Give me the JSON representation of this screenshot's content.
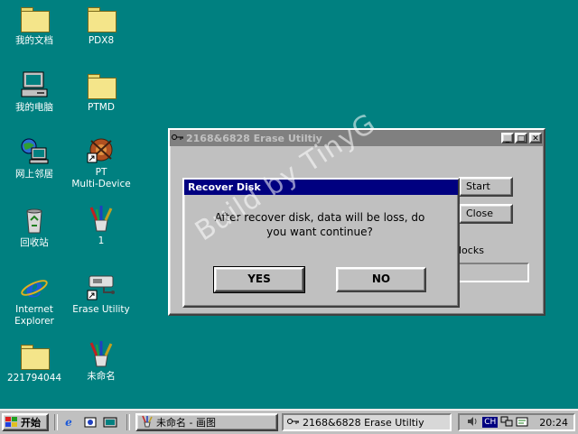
{
  "desktop": {
    "icons": [
      {
        "label": "我的文档"
      },
      {
        "label": "PDX8"
      },
      {
        "label": "我的电脑"
      },
      {
        "label": "PTMD"
      },
      {
        "label": "网上邻居"
      },
      {
        "label": "PT\nMulti-Device"
      },
      {
        "label": "回收站"
      },
      {
        "label": "1"
      },
      {
        "label": "Internet\nExplorer"
      },
      {
        "label": "Erase Utility"
      },
      {
        "label": "221794044"
      },
      {
        "label": "未命名"
      }
    ]
  },
  "main_window": {
    "title": "2168&6828 Erase Utiltiy",
    "start_label": "Start",
    "close_label": "Close",
    "partial_label": "locks"
  },
  "dialog": {
    "title": "Recover Disk",
    "message_line1": "After recover disk, data will be loss, do",
    "message_line2": "you want continue?",
    "yes_label": "YES",
    "no_label": "NO"
  },
  "watermark": "Build by TinyG",
  "taskbar": {
    "start_label": "开始",
    "tasks": [
      {
        "label": "未命名 - 画图"
      },
      {
        "label": "2168&6828 Erase Utiltiy"
      }
    ],
    "tray": {
      "ime": "CH",
      "clock": "20:24"
    }
  },
  "colors": {
    "desktop": "#008080",
    "title_active": "#000080",
    "title_inactive": "#808080",
    "face": "#c0c0c0"
  }
}
